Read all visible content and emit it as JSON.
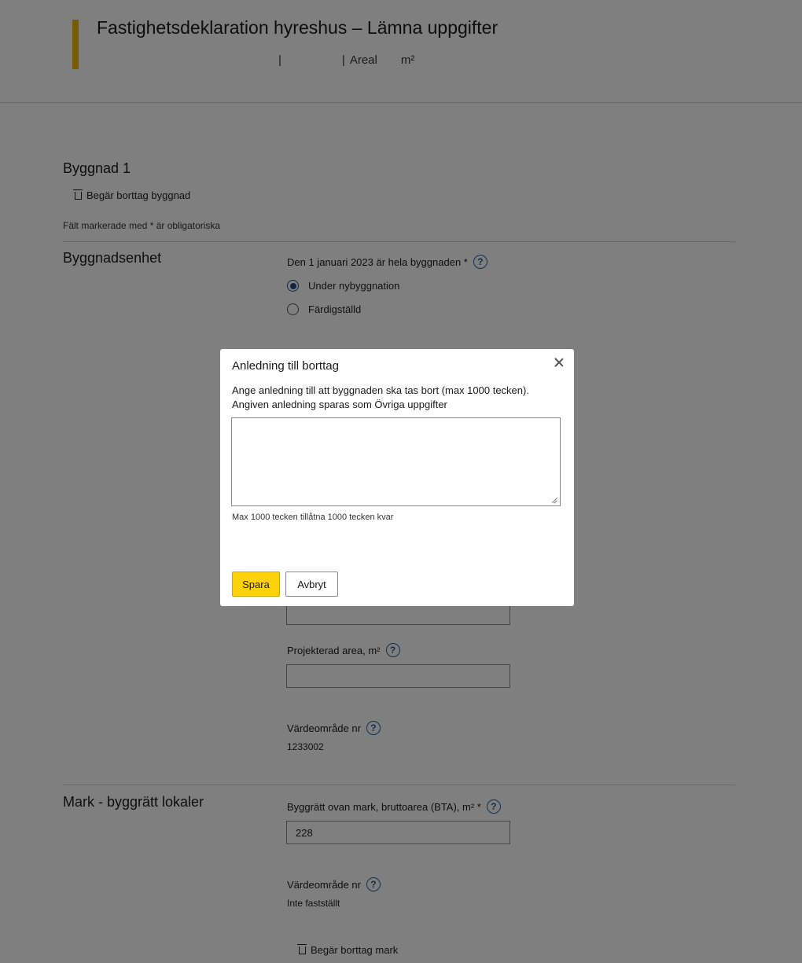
{
  "header": {
    "title": "Fastighetsdeklaration hyreshus – Lämna uppgifter",
    "separator": "|",
    "area_label": "Areal",
    "area_unit": "m²"
  },
  "building": {
    "title": "Byggnad 1",
    "remove_building_label": "Begär borttag byggnad",
    "required_note": "Fält markerade med * är obligatoriska"
  },
  "unit_section": {
    "title": "Byggnadsenhet",
    "status_question": "Den 1 januari 2023 är hela byggnaden *",
    "options": [
      "Under nybyggnation",
      "Färdigställd"
    ],
    "selected_option": "Under nybyggnation",
    "projected_area_label": "Projekterad area, m²",
    "projected_area_value": "",
    "value_area_label": "Värdeområde nr",
    "value_area_value": "1233002"
  },
  "land_section": {
    "title": "Mark - byggrätt lokaler",
    "bta_label": "Byggrätt ovan mark, bruttoarea (BTA), m² *",
    "bta_value": "228",
    "value_area_label": "Värdeområde nr",
    "value_area_value": "Inte fastställt",
    "remove_land_label": "Begär borttag mark"
  },
  "modal": {
    "title": "Anledning till borttag",
    "description_line1": "Ange anledning till att byggnaden ska tas bort (max 1000 tecken).",
    "description_line2": "Angiven anledning sparas som Övriga uppgifter",
    "textarea_value": "",
    "counter_text": "Max 1000 tecken tillåtna 1000 tecken kvar",
    "save_label": "Spara",
    "cancel_label": "Avbryt"
  },
  "colors": {
    "accent": "#f0b400",
    "primary_button": "#fdd20a",
    "help_icon": "#2b5c9e",
    "radio_selected": "#1f4f8a",
    "overlay": "rgba(0,0,0,0.5)"
  },
  "icons": [
    "trash-icon",
    "help-icon",
    "close-icon",
    "resize-grip-icon"
  ]
}
